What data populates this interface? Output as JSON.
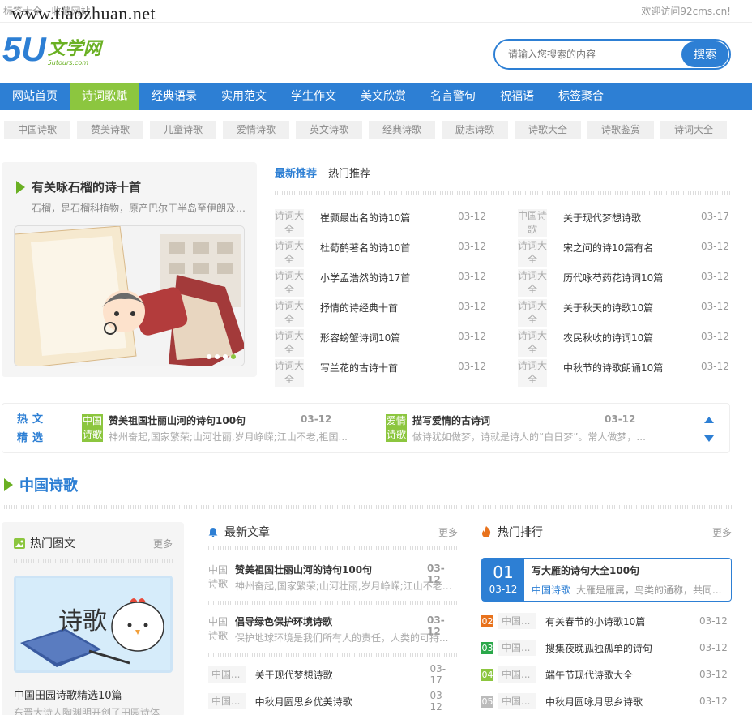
{
  "topbar": {
    "left": "标签大全 · 收藏网站",
    "watermark": "www.tiaozhuan.net",
    "right": "欢迎访问92cms.cn!"
  },
  "logo": {
    "num": "5U",
    "cn": "文学网",
    "en": "5utours.com"
  },
  "search": {
    "placeholder": "请输入您搜索的内容",
    "button": "搜索"
  },
  "nav": [
    {
      "label": "网站首页",
      "active": false
    },
    {
      "label": "诗词歌赋",
      "active": true
    },
    {
      "label": "经典语录",
      "active": false
    },
    {
      "label": "实用范文",
      "active": false
    },
    {
      "label": "学生作文",
      "active": false
    },
    {
      "label": "美文欣赏",
      "active": false
    },
    {
      "label": "名言警句",
      "active": false
    },
    {
      "label": "祝福语",
      "active": false
    },
    {
      "label": "标签聚合",
      "active": false
    }
  ],
  "subnav": [
    "中国诗歌",
    "赞美诗歌",
    "儿童诗歌",
    "爱情诗歌",
    "英文诗歌",
    "经典诗歌",
    "励志诗歌",
    "诗歌大全",
    "诗歌鉴赏",
    "诗词大全"
  ],
  "feature": {
    "title": "有关咏石榴的诗十首",
    "desc": "石榴，是石榴科植物，原产巴尔干半岛至伊朗及其邻近地区"
  },
  "tabs": {
    "latest": "最新推荐",
    "hot": "热门推荐"
  },
  "news_left": [
    {
      "tag": "诗词大全",
      "title": "崔颢最出名的诗10篇",
      "date": "03-12"
    },
    {
      "tag": "诗词大全",
      "title": "杜荀鹤著名的诗10首",
      "date": "03-12"
    },
    {
      "tag": "诗词大全",
      "title": "小学孟浩然的诗17首",
      "date": "03-12"
    },
    {
      "tag": "诗词大全",
      "title": "抒情的诗经典十首",
      "date": "03-12"
    },
    {
      "tag": "诗词大全",
      "title": "形容螃蟹诗词10篇",
      "date": "03-12"
    },
    {
      "tag": "诗词大全",
      "title": "写兰花的古诗十首",
      "date": "03-12"
    }
  ],
  "news_right": [
    {
      "tag": "中国诗歌",
      "title": "关于现代梦想诗歌",
      "date": "03-17"
    },
    {
      "tag": "诗词大全",
      "title": "宋之问的诗10篇有名",
      "date": "03-12"
    },
    {
      "tag": "诗词大全",
      "title": "历代咏芍药花诗词10篇",
      "date": "03-12"
    },
    {
      "tag": "诗词大全",
      "title": "关于秋天的诗歌10篇",
      "date": "03-12"
    },
    {
      "tag": "诗词大全",
      "title": "农民秋收的诗词10篇",
      "date": "03-12"
    },
    {
      "tag": "诗词大全",
      "title": "中秋节的诗歌朗诵10篇",
      "date": "03-12"
    }
  ],
  "hot": {
    "label1": "热文",
    "label2": "精选",
    "items": [
      {
        "tag": "中国诗歌",
        "title": "赞美祖国壮丽山河的诗句100句",
        "date": "03-12",
        "desc": "神州奋起,国家繁荣;山河壮丽,岁月峥嵘;江山不老,祖国..."
      },
      {
        "tag": "爱情诗歌",
        "title": "描写爱情的古诗词",
        "date": "03-12",
        "desc": "做诗犹如做梦，诗就是诗人的“白日梦”。常人做梦，..."
      }
    ]
  },
  "section": {
    "title": "中国诗歌"
  },
  "col1": {
    "title": "热门图文",
    "more": "更多",
    "pic_text": "诗歌",
    "caption": "中国田园诗歌精选10篇",
    "desc": "东晋大诗人陶渊明开创了田园诗体"
  },
  "col2": {
    "title": "最新文章",
    "more": "更多",
    "big": [
      {
        "tag": "中国诗歌",
        "title": "赞美祖国壮丽山河的诗句100句",
        "date": "03-12",
        "desc": "神州奋起,国家繁荣;山河壮丽,岁月峥嵘;江山不老,..."
      },
      {
        "tag": "中国诗歌",
        "title": "倡导绿色保护环境诗歌",
        "date": "03-12",
        "desc": "保护地球环境是我们所有人的责任，人类的可持..."
      }
    ],
    "small": [
      {
        "tag": "中国...",
        "title": "关于现代梦想诗歌",
        "date": "03-17"
      },
      {
        "tag": "中国...",
        "title": "中秋月圆思乡优美诗歌",
        "date": "03-12"
      }
    ]
  },
  "col3": {
    "title": "热门排行",
    "more": "更多",
    "top": {
      "num": "01",
      "date": "03-12",
      "title": "写大雁的诗句大全100句",
      "cat": "中国诗歌",
      "desc": "大雁是雁属，鸟类的通称，共同..."
    },
    "rows": [
      {
        "num": "02",
        "color": "#e8721c",
        "cat": "中国...",
        "title": "有关春节的小诗歌10篇",
        "date": "03-12"
      },
      {
        "num": "03",
        "color": "#2aa84a",
        "cat": "中国...",
        "title": "搜集夜晚孤独孤单的诗句",
        "date": "03-12"
      },
      {
        "num": "04",
        "color": "#8cc63f",
        "cat": "中国...",
        "title": "端午节现代诗歌大全",
        "date": "03-12"
      },
      {
        "num": "05",
        "color": "#bbbbbb",
        "cat": "中国...",
        "title": "中秋月圆咏月思乡诗歌",
        "date": "03-12"
      }
    ]
  },
  "colors": {
    "primary": "#2d7fd4",
    "green": "#8cc63f"
  }
}
